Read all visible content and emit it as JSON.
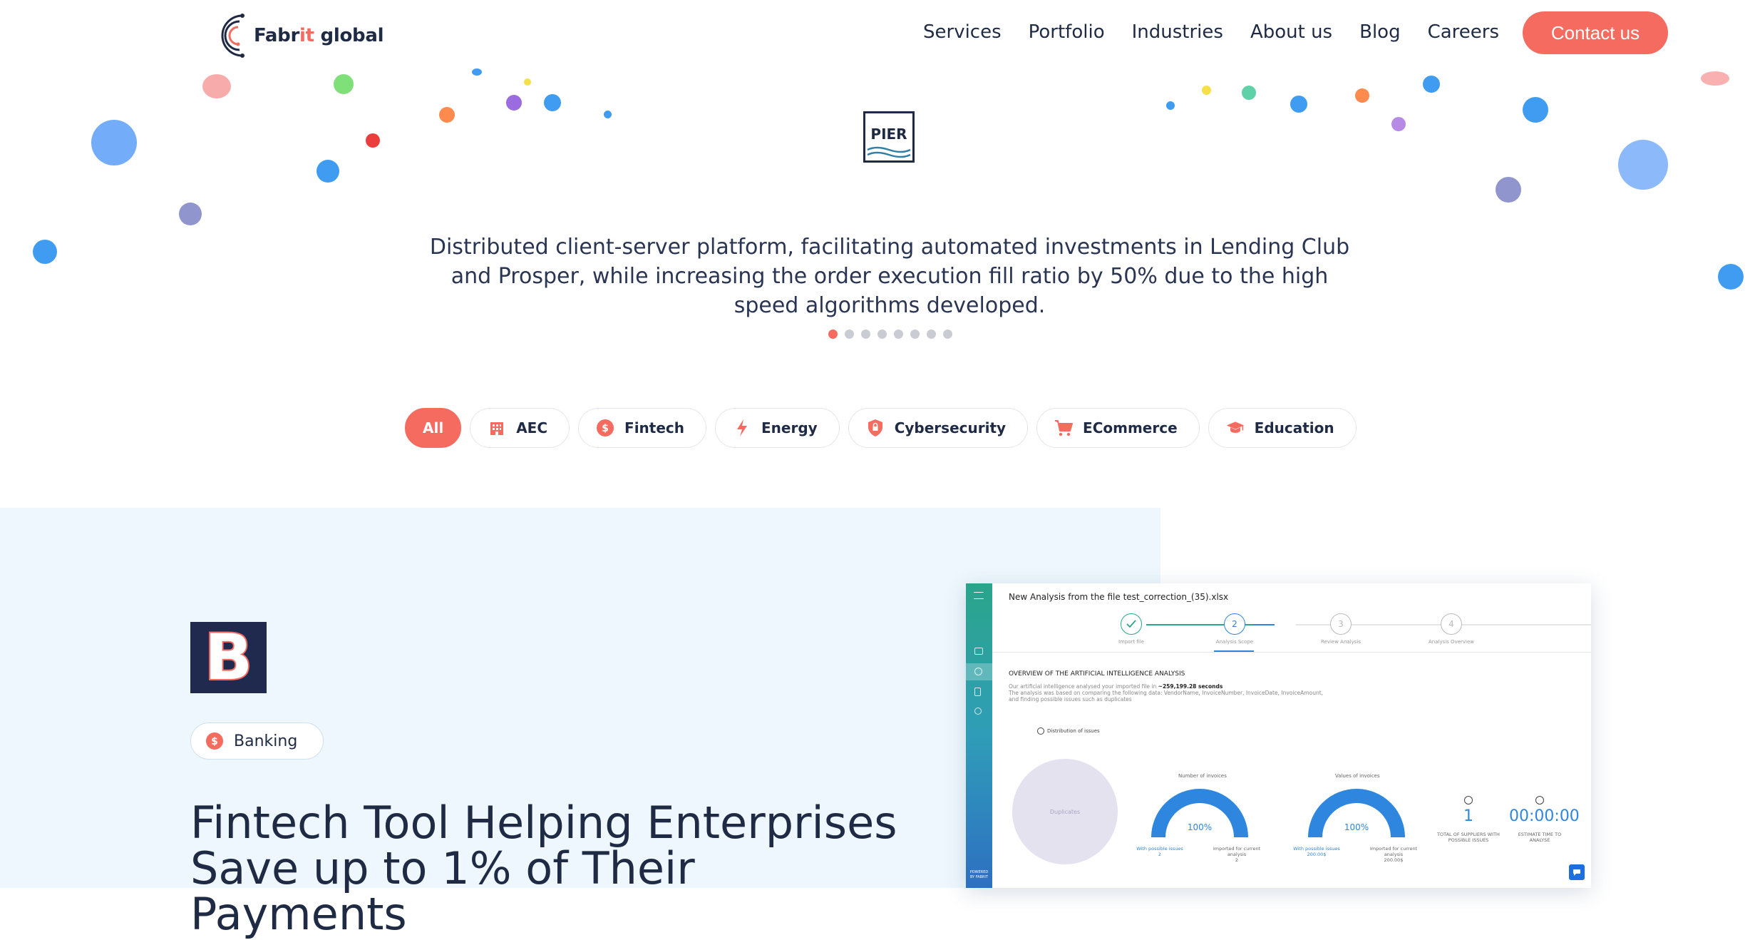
{
  "header": {
    "logo": {
      "text_main": "Fabr",
      "text_accent": "it",
      "text_rest": " global"
    },
    "nav": [
      "Services",
      "Portfolio",
      "Industries",
      "About us",
      "Blog",
      "Careers"
    ],
    "contact_label": "Contact us"
  },
  "hero": {
    "client_logo_text": "PIER",
    "description": "Distributed client-server platform, facilitating automated investments in Lending Club and Prosper, while increasing the order execution fill ratio by 50% due to the high speed algorithms developed.",
    "slides_total": 8,
    "active_slide": 1
  },
  "filters": [
    {
      "label": "All",
      "icon": "",
      "active": true
    },
    {
      "label": "AEC",
      "icon": "building-icon"
    },
    {
      "label": "Fintech",
      "icon": "dollar-icon"
    },
    {
      "label": "Energy",
      "icon": "lightning-icon"
    },
    {
      "label": "Cybersecurity",
      "icon": "shield-icon"
    },
    {
      "label": "ECommerce",
      "icon": "cart-icon"
    },
    {
      "label": "Education",
      "icon": "graduation-cap-icon"
    }
  ],
  "case": {
    "brand_letter": "B",
    "tag": "Banking",
    "title_line1": "Fintech Tool Helping Enterprises",
    "title_line2": "Save up to 1% of Their Payments"
  },
  "screenshot": {
    "title": "New Analysis from the file test_correction_(35).xlsx",
    "steps": [
      {
        "num": "",
        "label": "Import file"
      },
      {
        "num": "2",
        "label": "Analysis Scope"
      },
      {
        "num": "3",
        "label": "Review Analysis"
      },
      {
        "num": "4",
        "label": "Analysis Overview"
      }
    ],
    "overview_heading": "OVERVIEW OF THE ARTIFICIAL INTELLIGENCE ANALYSIS",
    "overview_line1": "Our artificial intelligence analysed your imported file in ",
    "overview_time": "~259,199.28 seconds",
    "overview_line2": "The analysis was based on comparing the following data: VendorName, InvoiceNumber, InvoiceDate, InvoiceAmount,",
    "overview_line3": "and finding possible issues such as duplicates",
    "pie_title": "Distribution of issues",
    "pie_label": "Duplicates",
    "gauge1_title": "Number of invoices",
    "gauge1_value": "100%",
    "gauge1_left": "With possible issues",
    "gauge1_left_val": "2",
    "gauge1_right": "Imported for current analysis",
    "gauge1_right_val": "2",
    "gauge2_title": "Values of invoices",
    "gauge2_value": "100%",
    "gauge2_left": "With possible issues",
    "gauge2_left_val": "200.00$",
    "gauge2_right": "Imported for current analysis",
    "gauge2_right_val": "200.00$",
    "kpi1_value": "1",
    "kpi1_label": "TOTAL OF SUPPLIERS WITH POSSIBLE ISSUES",
    "kpi2_value": "00:00:00",
    "kpi2_label": "ESTIMATE TIME TO ANALYSE",
    "sidebar_footer": "POWERED BY FABRIT"
  },
  "colors": {
    "accent": "#f56b5f",
    "navy": "#1f2a44",
    "case_bg": "#eef7fd",
    "kpi_blue": "#2e86de"
  }
}
